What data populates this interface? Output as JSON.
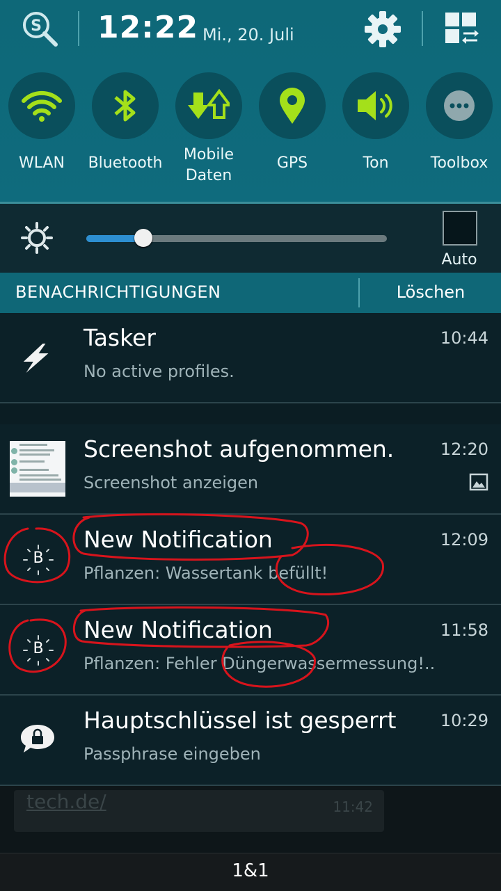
{
  "status": {
    "time": "12:22",
    "date": "Mi., 20. Juli"
  },
  "quick_settings": [
    {
      "label": "WLAN",
      "icon": "wifi-icon"
    },
    {
      "label": "Bluetooth",
      "icon": "bluetooth-icon"
    },
    {
      "label": "Mobile\nDaten",
      "icon": "mobile-data-icon"
    },
    {
      "label": "GPS",
      "icon": "gps-icon"
    },
    {
      "label": "Ton",
      "icon": "sound-icon"
    },
    {
      "label": "Toolbox",
      "icon": "toolbox-icon"
    }
  ],
  "brightness": {
    "level": 0.19,
    "auto_label": "Auto"
  },
  "notifications_header": {
    "title": "BENACHRICHTIGUNGEN",
    "clear_label": "Löschen"
  },
  "notifications": [
    {
      "title": "Tasker",
      "subtitle": "No active profiles.",
      "time": "10:44",
      "icon": "tasker-bolt-icon"
    },
    {
      "title": "Screenshot aufgenommen.",
      "subtitle": "Screenshot anzeigen",
      "time": "12:20",
      "icon": "screenshot-thumbnail"
    },
    {
      "title": "New Notification",
      "subtitle": "Pflanzen: Wassertank befüllt!",
      "time": "12:09",
      "icon": "b-app-icon",
      "icon_letter": "B"
    },
    {
      "title": "New Notification",
      "subtitle": "Pflanzen: Fehler Düngerwassermessung!..",
      "time": "11:58",
      "icon": "b-app-icon",
      "icon_letter": "B"
    },
    {
      "title": "Hauptschlüssel ist gesperrt",
      "subtitle": "Passphrase eingeben",
      "time": "10:29",
      "icon": "lock-bubble-icon"
    }
  ],
  "background": {
    "link_text": "tech.de/",
    "time": "11:42"
  },
  "carrier": "1&1",
  "colors": {
    "header": "#0f6b7d",
    "accent_green": "#a4e01a",
    "annotation_red": "#d8141c"
  }
}
